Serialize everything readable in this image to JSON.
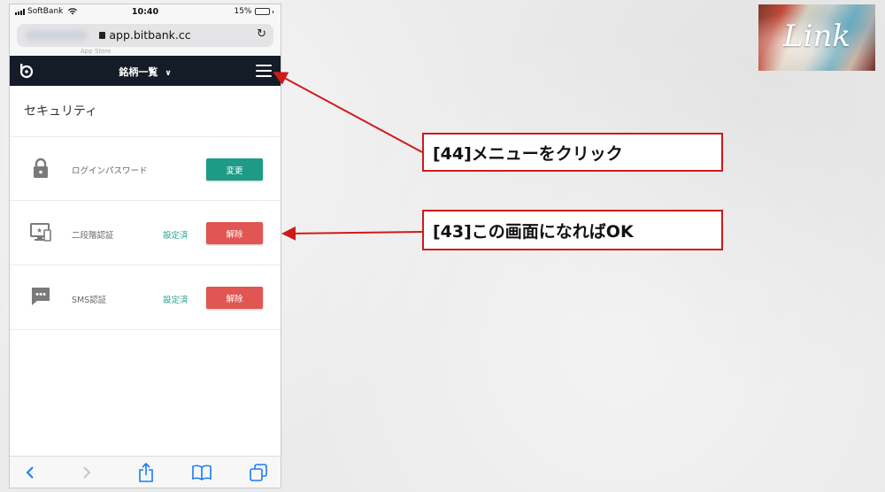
{
  "statusbar": {
    "carrier": "SoftBank",
    "time": "10:40",
    "battery": "15%",
    "battery_level": 0.15
  },
  "browser": {
    "url": "app.bitbank.cc",
    "bookmark_hint": "App Store"
  },
  "navbar": {
    "title": "銘柄一覧",
    "menu_icon": "hamburger-icon",
    "dropdown_icon": "chevron-down-icon"
  },
  "page": {
    "title": "セキュリティ"
  },
  "security_items": [
    {
      "icon": "lock-icon",
      "label": "ログインパスワード",
      "status": "",
      "button": "変更",
      "button_color": "#1d9b86"
    },
    {
      "icon": "monitor-icon",
      "label": "二段階認証",
      "status": "設定済",
      "button": "解除",
      "button_color": "#e15552"
    },
    {
      "icon": "chat-icon",
      "label": "SMS認証",
      "status": "設定済",
      "button": "解除",
      "button_color": "#e15552"
    }
  ],
  "annotations": {
    "step44": "[44]メニューをクリック",
    "step43": "[43]この画面になればOK",
    "accent_color": "#d01a1a"
  },
  "brand": {
    "text": "Link"
  },
  "colors": {
    "navbar": "#141c27",
    "status_text": "#27a391"
  }
}
